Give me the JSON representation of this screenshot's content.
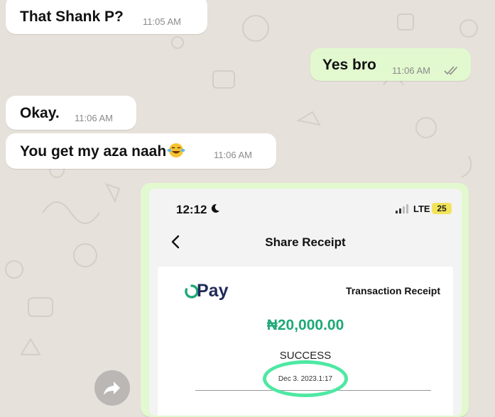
{
  "chat": {
    "messages": [
      {
        "direction": "incoming",
        "text": "That Shank P?",
        "time": "11:05 AM"
      },
      {
        "direction": "outgoing",
        "text": "Yes bro",
        "time": "11:06 AM",
        "status": "read"
      },
      {
        "direction": "incoming",
        "text": "Okay.",
        "time": "11:06 AM"
      },
      {
        "direction": "incoming",
        "text": "You get my aza naah",
        "emoji": "face-with-tears-of-joy",
        "time": "11:06 AM"
      }
    ]
  },
  "receipt_screenshot": {
    "status_bar": {
      "time": "12:12",
      "network": "LTE",
      "battery": "25"
    },
    "nav": {
      "title": "Share Receipt",
      "back_icon": "chevron-left-icon"
    },
    "brand": {
      "o": "O",
      "name": "Pay"
    },
    "receipt_title": "Transaction Receipt",
    "amount": "₦20,000.00",
    "status": "SUCCESS",
    "date": "Dec 3. 2023.1:17"
  },
  "annotation": {
    "ring_color": "#4ee8a3"
  },
  "colors": {
    "chat_background": "#e6e1da",
    "outgoing_bubble": "#e2f9cf",
    "incoming_bubble": "#ffffff",
    "amount_green": "#1fa877",
    "brand_navy": "#1f2a5a"
  },
  "icons": [
    "moon-icon",
    "signal-icon",
    "chevron-left-icon",
    "forward-icon",
    "double-check-icon",
    "emoji-laughing-icon"
  ]
}
